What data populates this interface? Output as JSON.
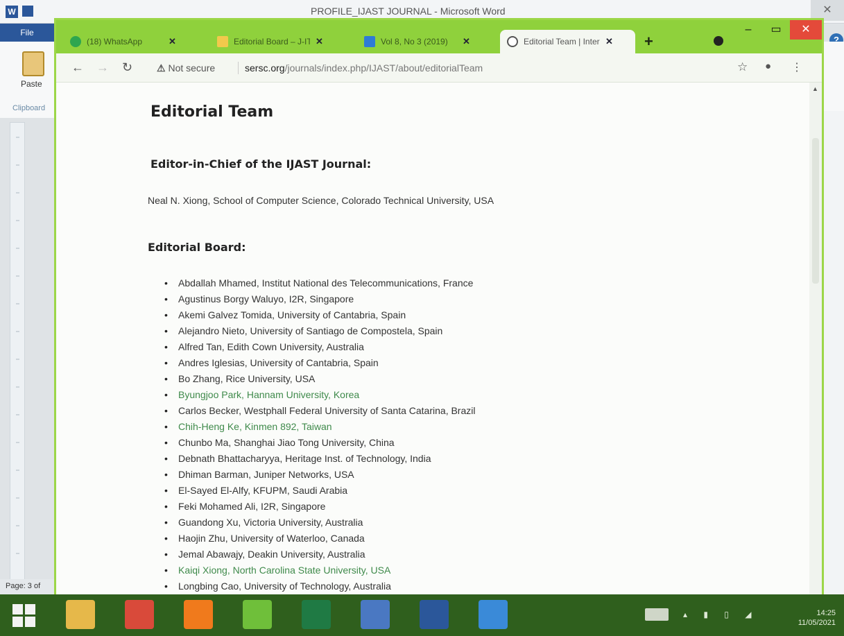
{
  "word": {
    "title": "PROFILE_IJAST JOURNAL - Microsoft Word",
    "file_tab": "File",
    "paste_label": "Paste",
    "clipboard_label": "Clipboard",
    "status_page": "Page: 3 of"
  },
  "browser": {
    "tabs": [
      {
        "label": "(18) WhatsApp",
        "icon": "whatsapp-icon",
        "color": "#25d366"
      },
      {
        "label": "Editorial Board – J-IT",
        "icon": "folder-icon",
        "color": "#f2c94c"
      },
      {
        "label": "Vol 8, No 3 (2019)",
        "icon": "ijast-icon",
        "color": "#2e7bd6"
      },
      {
        "label": "Editorial Team | Inter",
        "icon": "globe-icon",
        "color": "#555555"
      }
    ],
    "new_tab": "+",
    "security_label": "Not secure",
    "url_host": "sersc.org",
    "url_path": "/journals/index.php/IJAST/about/editorialTeam"
  },
  "page": {
    "title": "Editorial Team",
    "chief_heading": "Editor-in-Chief of the IJAST Journal:",
    "chief_name": "Neal N. Xiong, School of Computer Science, Colorado Technical University, USA",
    "board_heading": "Editorial Board:",
    "board": [
      {
        "text": "Abdallah Mhamed, Institut National des Telecommunications, France",
        "link": false
      },
      {
        "text": "Agustinus Borgy Waluyo, I2R, Singapore",
        "link": false
      },
      {
        "text": "Akemi Galvez Tomida, University of Cantabria, Spain",
        "link": false
      },
      {
        "text": "Alejandro Nieto, University of Santiago de Compostela, Spain",
        "link": false
      },
      {
        "text": "Alfred Tan, Edith Cown University, Australia",
        "link": false
      },
      {
        "text": "Andres Iglesias, University of Cantabria, Spain",
        "link": false
      },
      {
        "text": "Bo Zhang, Rice University, USA",
        "link": false
      },
      {
        "text": "Byungjoo Park, Hannam University, Korea",
        "link": true
      },
      {
        "text": "Carlos Becker, Westphall Federal University of Santa Catarina, Brazil",
        "link": false
      },
      {
        "text": "Chih-Heng Ke, Kinmen 892, Taiwan",
        "link": true
      },
      {
        "text": "Chunbo Ma, Shanghai Jiao Tong University, China",
        "link": false
      },
      {
        "text": "Debnath Bhattacharyya, Heritage Inst. of Technology, India",
        "link": false
      },
      {
        "text": "Dhiman Barman, Juniper Networks, USA",
        "link": false
      },
      {
        "text": "El-Sayed El-Alfy, KFUPM, Saudi Arabia",
        "link": false
      },
      {
        "text": "Feki Mohamed Ali, I2R, Singapore",
        "link": false
      },
      {
        "text": "Guandong Xu, Victoria University, Australia",
        "link": false
      },
      {
        "text": "Haojin Zhu, University of Waterloo, Canada",
        "link": false
      },
      {
        "text": "Jemal Abawajy, Deakin University, Australia",
        "link": false
      },
      {
        "text": "Kaiqi Xiong, North Carolina State University, USA",
        "link": true
      },
      {
        "text": "Longbing Cao, University of Technology, Australia",
        "link": false
      }
    ]
  },
  "taskbar": {
    "time": "14:25",
    "date": "11/05/2021",
    "apps": [
      {
        "name": "file-explorer-icon",
        "color": "#e6b84a"
      },
      {
        "name": "chrome-icon",
        "color": "#d94a3a"
      },
      {
        "name": "firefox-icon",
        "color": "#f07a1c"
      },
      {
        "name": "bar-chart-app-icon",
        "color": "#6fbf3a"
      },
      {
        "name": "excel-icon",
        "color": "#1f7a44"
      },
      {
        "name": "r-app-icon",
        "color": "#4a78c2"
      },
      {
        "name": "word-icon",
        "color": "#2b579a"
      },
      {
        "name": "paint-app-icon",
        "color": "#3a8ad8"
      }
    ]
  }
}
